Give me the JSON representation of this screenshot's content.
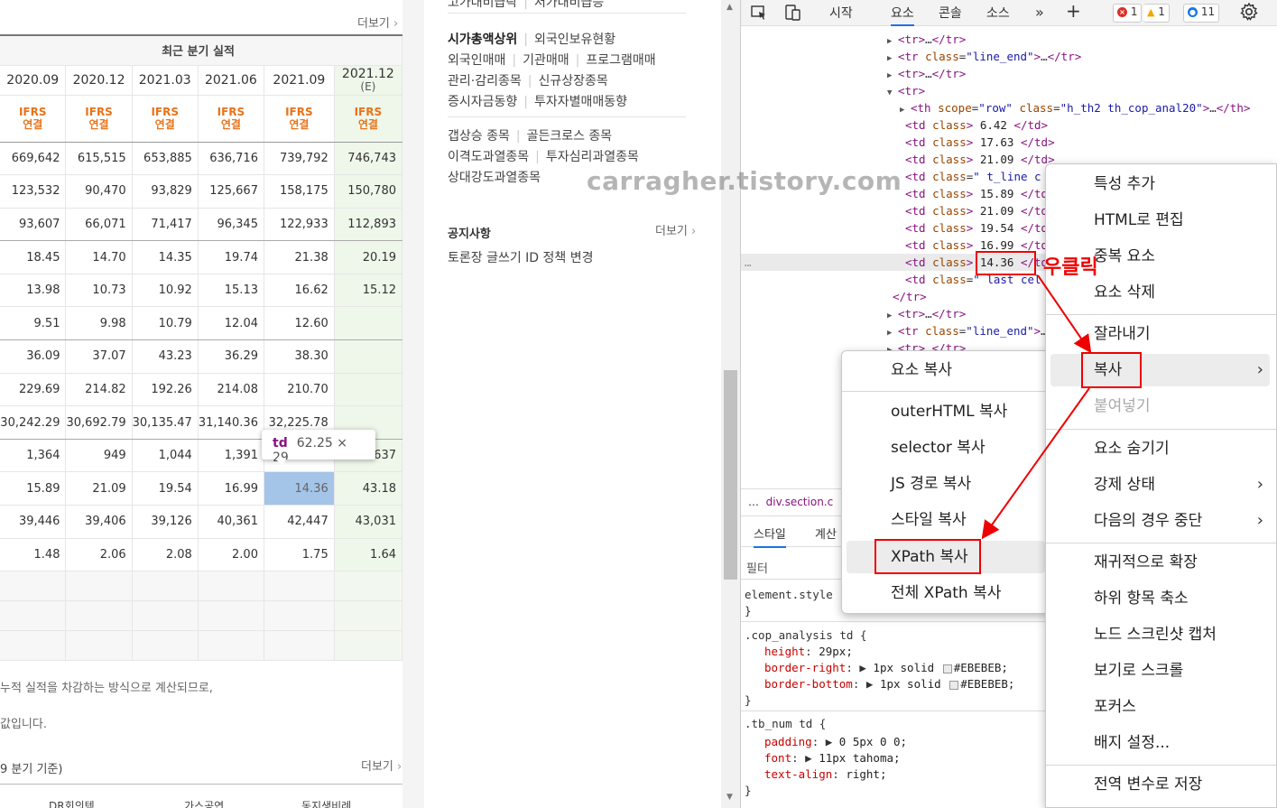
{
  "left": {
    "more1": "더보기",
    "section_title": "최근 분기 실적",
    "periods": [
      "2020.09",
      "2020.12",
      "2021.03",
      "2021.06",
      "2021.09"
    ],
    "estimate_period": "2021.12",
    "estimate_mark": "(E)",
    "ifrs_top": "IFRS",
    "ifrs_bottom": "연결",
    "rows": [
      [
        "669,642",
        "615,515",
        "653,885",
        "636,716",
        "739,792",
        "746,743"
      ],
      [
        "123,532",
        "90,470",
        "93,829",
        "125,667",
        "158,175",
        "150,780"
      ],
      [
        "93,607",
        "66,071",
        "71,417",
        "96,345",
        "122,933",
        "112,893"
      ],
      [
        "18.45",
        "14.70",
        "14.35",
        "19.74",
        "21.38",
        "20.19"
      ],
      [
        "13.98",
        "10.73",
        "10.92",
        "15.13",
        "16.62",
        "15.12"
      ],
      [
        "9.51",
        "9.98",
        "10.79",
        "12.04",
        "12.60",
        ""
      ],
      [
        "36.09",
        "37.07",
        "43.23",
        "36.29",
        "38.30",
        ""
      ],
      [
        "229.69",
        "214.82",
        "192.26",
        "214.08",
        "210.70",
        ""
      ],
      [
        "30,242.29",
        "30,692.79",
        "30,135.47",
        "31,140.36",
        "32,225.78",
        ""
      ],
      [
        "1,364",
        "949",
        "1,044",
        "1,391",
        "",
        "637"
      ],
      [
        "15.89",
        "21.09",
        "19.54",
        "16.99",
        "14.36",
        "43.18"
      ],
      [
        "39,446",
        "39,406",
        "39,126",
        "40,361",
        "42,447",
        "43,031"
      ],
      [
        "1.48",
        "2.06",
        "2.08",
        "2.00",
        "1.75",
        "1.64"
      ]
    ],
    "tooltip_tag": "td",
    "tooltip_dim": "62.25 × 29",
    "note1": "누적 실적을 차감하는 방식으로 계산되므로,",
    "note2": "값입니다.",
    "note3": "9 분기 기준)",
    "more2": "더보기",
    "foot_cells": [
      "DR회의텍",
      "가스공연",
      "동지생비례"
    ]
  },
  "middle": {
    "row0": [
      "고가대비급락",
      "저가대비급등"
    ],
    "group1": [
      [
        "시가총액상위",
        "외국인보유현황"
      ],
      [
        "외국인매매",
        "기관매매",
        "프로그램매매"
      ],
      [
        "관리·감리종목",
        "신규상장종목"
      ],
      [
        "증시자금동향",
        "투자자별매매동향"
      ]
    ],
    "group2": [
      [
        "갭상승 종목",
        "골든크로스 종목"
      ],
      [
        "이격도과열종목",
        "투자심리과열종목"
      ],
      [
        "상대강도과열종목"
      ]
    ],
    "notice_title": "공지사항",
    "notice_more": "더보기",
    "notice_item": "토론장 글쓰기 ID 정책 변경"
  },
  "watermark": "carragher.tistory.com",
  "devtools": {
    "tabs": [
      "시작",
      "요소",
      "콘솔",
      "소스"
    ],
    "badges": {
      "errors": "1",
      "warnings": "1",
      "info": "11"
    },
    "breadcrumb": "div.section.c",
    "subtabs": [
      "스타일",
      "계산"
    ],
    "filter": "필터",
    "dom": {
      "row": "row",
      "th_class": "h_th2 th_cop_anal20",
      "line_end": "line_end",
      "values": [
        "6.42",
        "17.63",
        "21.09",
        "",
        "15.89",
        "21.09",
        "19.54",
        "16.99",
        "14.36"
      ],
      "t_line": " t_line c",
      "last_cell": " last cel"
    },
    "styles": {
      "element_style": "element.style",
      "rule1_selector": ".cop_analysis td",
      "rule1": [
        [
          "height",
          "29px;"
        ],
        [
          "border-right",
          "1px solid",
          "#EBEBEB;"
        ],
        [
          "border-bottom",
          "1px solid",
          "#EBEBEB;"
        ]
      ],
      "rule2_selector": ".tb_num td",
      "rule2": [
        [
          "padding",
          "0 5px 0 0;"
        ],
        [
          "font",
          "11px tahoma;"
        ],
        [
          "text-align",
          "right;"
        ]
      ]
    }
  },
  "copy_menu": [
    "요소 복사",
    "outerHTML 복사",
    "selector 복사",
    "JS 경로 복사",
    "스타일 복사",
    "XPath 복사",
    "전체 XPath 복사"
  ],
  "context_menu": [
    "특성 추가",
    "HTML로 편집",
    "중복 요소",
    "요소 삭제",
    "잘라내기",
    "복사",
    "붙여넣기",
    "요소 숨기기",
    "강제 상태",
    "다음의 경우 중단",
    "재귀적으로 확장",
    "하위 항목 축소",
    "노드 스크린샷 캡처",
    "보기로 스크롤",
    "포커스",
    "배지 설정...",
    "전역 변수로 저장"
  ],
  "annotation": "우클릭",
  "colors": {
    "accent": "#1a73e8",
    "annotation": "#ee0000",
    "ifrs": "#e8731a",
    "tag": "#881280"
  }
}
